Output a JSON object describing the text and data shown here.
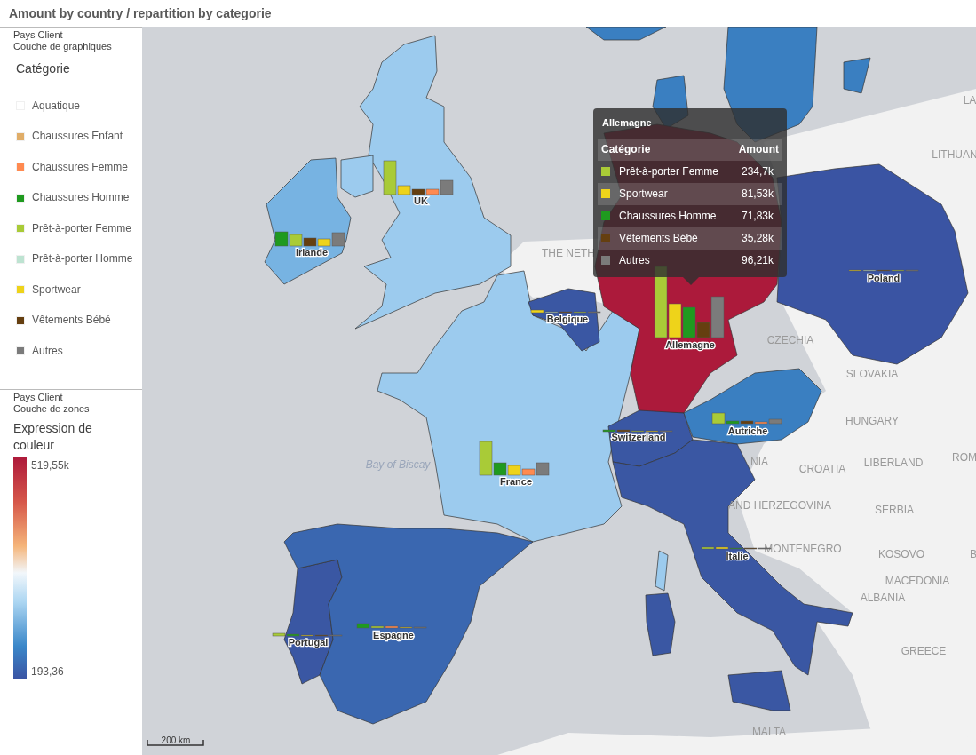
{
  "title": "Amount by country / repartition by categorie",
  "legend": {
    "layer_field": "Pays Client",
    "layer_name": "Couche de graphiques",
    "heading": "Catégorie",
    "items": [
      {
        "label": "Aquatique",
        "color": "#ffffff"
      },
      {
        "label": "Chaussures Enfant",
        "color": "#e0ad68"
      },
      {
        "label": "Chaussures Femme",
        "color": "#ff8a50"
      },
      {
        "label": "Chaussures Homme",
        "color": "#1f9a1f"
      },
      {
        "label": "Prêt-à-porter Femme",
        "color": "#a9cb37"
      },
      {
        "label": "Prêt-à-porter Homme",
        "color": "#bde3d1"
      },
      {
        "label": "Sportwear",
        "color": "#eed31a"
      },
      {
        "label": "Vêtements Bébé",
        "color": "#653f10"
      },
      {
        "label": "Autres",
        "color": "#7b7b7b"
      }
    ]
  },
  "color_legend": {
    "layer_field": "Pays Client",
    "layer_name": "Couche de zones",
    "heading": "Expression de couleur",
    "max": "519,55k",
    "min": "193,36"
  },
  "countries": [
    {
      "label": "UK",
      "color": "#9ccbee"
    },
    {
      "label": "Irlande",
      "color": "#77b3e2"
    },
    {
      "label": "France",
      "color": "#9ccbee"
    },
    {
      "label": "Belgique",
      "color": "#3a57a3"
    },
    {
      "label": "Allemagne",
      "color": "#ac1a3b"
    },
    {
      "label": "Poland",
      "color": "#3a54a3"
    },
    {
      "label": "Switzerland",
      "color": "#3a57a3"
    },
    {
      "label": "Autriche",
      "color": "#3a7fc1"
    },
    {
      "label": "Italie",
      "color": "#3a57a3"
    },
    {
      "label": "Portugal",
      "color": "#3a57a3"
    },
    {
      "label": "Espagne",
      "color": "#3a67b0"
    }
  ],
  "basemap_labels": [
    "LA",
    "LITHUAN",
    "THE NETH",
    "CZECHIA",
    "SLOVAKIA",
    "HUNGARY",
    "ROM",
    "NIA",
    "LIBERLAND",
    "CROATIA",
    "AND HERZEGOVINA",
    "SERBIA",
    "MONTENEGRO",
    "B",
    "KOSOVO",
    "MACEDONIA",
    "ALBANIA",
    "GREECE",
    "MALTA",
    "Bay of Biscay"
  ],
  "tooltip": {
    "title": "Allemagne",
    "columns": [
      "Catégorie",
      "Amount"
    ],
    "rows": [
      {
        "category": "Prêt-à-porter Femme",
        "amount": "234,7k",
        "color": "#a9cb37"
      },
      {
        "category": "Sportwear",
        "amount": "81,53k",
        "color": "#eed31a"
      },
      {
        "category": "Chaussures Homme",
        "amount": "71,83k",
        "color": "#1f9a1f"
      },
      {
        "category": "Vêtements Bébé",
        "amount": "35,28k",
        "color": "#653f10"
      },
      {
        "category": "Autres",
        "amount": "96,21k",
        "color": "#7b7b7b"
      }
    ]
  },
  "scale": "200 km"
}
